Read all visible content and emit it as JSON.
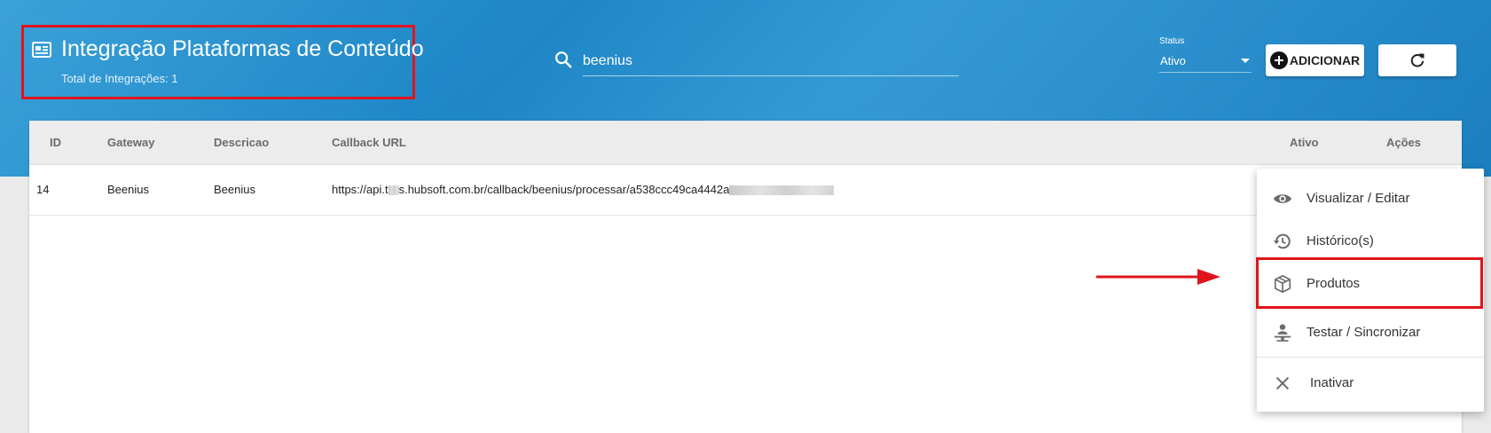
{
  "header": {
    "title": "Integração Plataformas de Conteúdo",
    "subtitle": "Total de Integrações: 1",
    "search": {
      "value": "beenius"
    },
    "status": {
      "label": "Status",
      "value": "Ativo"
    },
    "add_button": "ADICIONAR"
  },
  "table": {
    "columns": [
      "ID",
      "Gateway",
      "Descricao",
      "Callback URL",
      "Ativo",
      "Ações"
    ],
    "rows": [
      {
        "id": "14",
        "gateway": "Beenius",
        "descricao": "Beenius",
        "callback_prefix": "https://api.t",
        "callback_mid": "s.hubsoft.com.br/callback/beenius/processar/a538ccc49ca4442a"
      }
    ]
  },
  "menu": {
    "items": [
      {
        "label": "Visualizar / Editar",
        "icon": "eye-icon"
      },
      {
        "label": "Histórico(s)",
        "icon": "history-icon"
      },
      {
        "label": "Produtos",
        "icon": "package-icon"
      },
      {
        "label": "Testar / Sincronizar",
        "icon": "sync-person-icon"
      },
      {
        "label": "Inativar",
        "icon": "close-icon"
      }
    ]
  },
  "colors": {
    "header_blue": "#2190cd",
    "highlight_red": "#e0141b"
  }
}
